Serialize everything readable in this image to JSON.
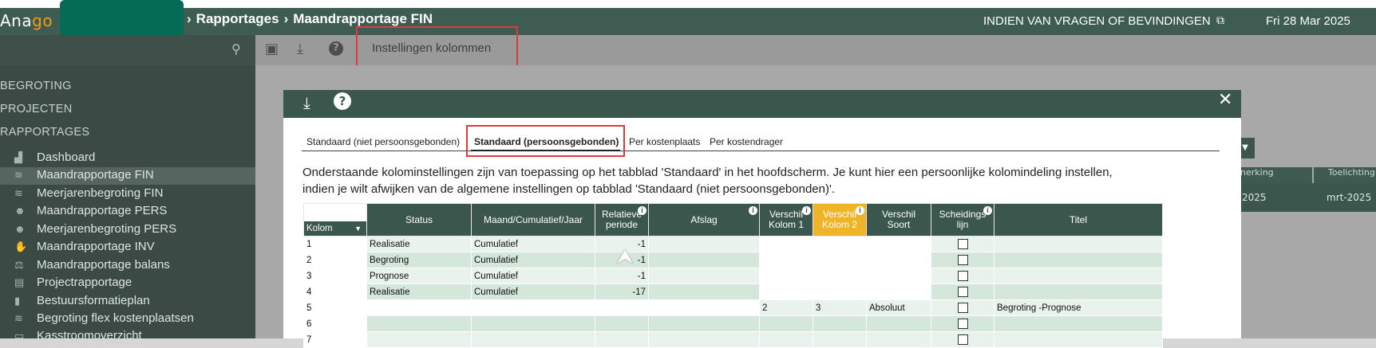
{
  "header": {
    "logo_a": "Ana",
    "logo_b": "go",
    "breadcrumb_sep": "›",
    "breadcrumb_1": "Rapportages",
    "breadcrumb_2": "Maandrapportage FIN",
    "help_link": "INDIEN VAN VRAGEN OF BEVINDINGEN",
    "date": "Fri 28 Mar 2025"
  },
  "sidebar": {
    "sections": [
      "BEGROTING",
      "PROJECTEN",
      "RAPPORTAGES"
    ],
    "items": [
      {
        "label": "Dashboard",
        "icon": "chart-icon"
      },
      {
        "label": "Maandrapportage FIN",
        "icon": "coins-icon"
      },
      {
        "label": "Meerjarenbegroting FIN",
        "icon": "coins-icon"
      },
      {
        "label": "Maandrapportage PERS",
        "icon": "users-icon"
      },
      {
        "label": "Meerjarenbegroting PERS",
        "icon": "users-icon"
      },
      {
        "label": "Maandrapportage INV",
        "icon": "hand-icon"
      },
      {
        "label": "Maandrapportage balans",
        "icon": "balance-icon"
      },
      {
        "label": "Projectrapportage",
        "icon": "clipboard-icon"
      },
      {
        "label": "Bestuursformatieplan",
        "icon": "book-icon"
      },
      {
        "label": "Begroting flex kostenplaatsen",
        "icon": "coins-icon"
      },
      {
        "label": "Kasstroomoverzicht",
        "icon": "cash-icon"
      }
    ]
  },
  "toolbar": {
    "columns_settings": "Instellingen kolommen"
  },
  "background_table": {
    "head_1": "nerking",
    "head_2": "Toelichting",
    "val_1": "2025",
    "val_2": "mrt-2025"
  },
  "modal": {
    "tabs": [
      "Standaard (niet persoonsgebonden)",
      "Standaard (persoonsgebonden)",
      "Per kostenplaats",
      "Per kostendrager"
    ],
    "info_line_1": "Onderstaande kolominstellingen zijn van toepassing op het tabblad 'Standaard' in het hoofdscherm. Je kunt hier een persoonlijke kolomindeling instellen,",
    "info_line_2": "indien je wilt afwijken van de algemene instellingen op tabblad 'Standaard (niet persoonsgebonden)'.",
    "columns": {
      "kolom": "Kolom",
      "status": "Status",
      "maand": "Maand/Cumulatief/Jaar",
      "relatieve_1": "Relatieve",
      "relatieve_2": "periode",
      "afslag": "Afslag",
      "verschil1_1": "Verschil",
      "verschil1_2": "Kolom 1",
      "verschil2_1": "Verschil",
      "verschil2_2": "Kolom 2",
      "soort_1": "Verschil",
      "soort_2": "Soort",
      "scheiding_1": "Scheidings",
      "scheiding_2": "lijn",
      "titel": "Titel"
    },
    "rows": [
      {
        "kolom": "1",
        "status": "Realisatie",
        "maand": "Cumulatief",
        "rel": "-1",
        "afslag": "",
        "v1": "",
        "v2": "",
        "soort": "",
        "titel": ""
      },
      {
        "kolom": "2",
        "status": "Begroting",
        "maand": "Cumulatief",
        "rel": "-1",
        "afslag": "",
        "v1": "",
        "v2": "",
        "soort": "",
        "titel": ""
      },
      {
        "kolom": "3",
        "status": "Prognose",
        "maand": "Cumulatief",
        "rel": "-1",
        "afslag": "",
        "v1": "",
        "v2": "",
        "soort": "",
        "titel": ""
      },
      {
        "kolom": "4",
        "status": "Realisatie",
        "maand": "Cumulatief",
        "rel": "-17",
        "afslag": "",
        "v1": "",
        "v2": "",
        "soort": "",
        "titel": ""
      },
      {
        "kolom": "5",
        "status": "",
        "maand": "",
        "rel": "",
        "afslag": "",
        "v1": "2",
        "v2": "3",
        "soort": "Absoluut",
        "titel": "Begroting -Prognose"
      },
      {
        "kolom": "6",
        "status": "",
        "maand": "",
        "rel": "",
        "afslag": "",
        "v1": "",
        "v2": "",
        "soort": "",
        "titel": ""
      },
      {
        "kolom": "7",
        "status": "",
        "maand": "",
        "rel": "",
        "afslag": "",
        "v1": "",
        "v2": "",
        "soort": "",
        "titel": ""
      }
    ]
  },
  "colors": {
    "header_green": "#3f5c52",
    "modal_green": "#3b564c",
    "accent_orange": "#f39c12",
    "highlight_yellow": "#f0b429",
    "annotation_red": "#e03a3a"
  }
}
